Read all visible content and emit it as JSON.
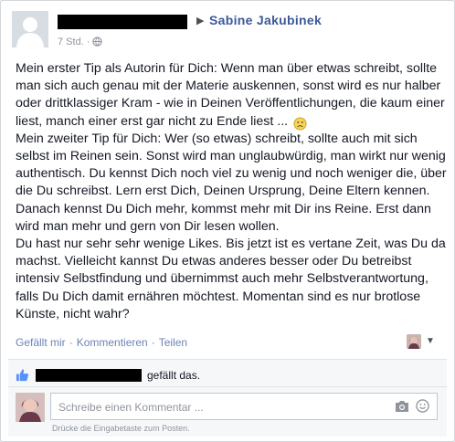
{
  "post": {
    "author_name": "Sabine Jakubinek",
    "time": "7 Std.",
    "separator": "·",
    "text": "Mein erster Tip als Autorin für Dich: Wenn man über etwas schreibt, sollte man sich auch genau mit der Materie auskennen, sonst wird es nur halber oder drittklassiger Kram - wie in Deinen Veröffentlichungen, die kaum einer liest, manch einer erst gar nicht zu Ende liest ...\nMein zweiter Tip für Dich: Wer (so etwas) schreibt, sollte auch mit sich selbst im Reinen sein. Sonst wird man unglaubwürdig, man wirkt nur wenig authentisch. Du kennst Dich noch viel zu wenig und noch weniger die, über die Du schreibst. Lern erst Dich, Deinen Ursprung, Deine Eltern kennen. Danach kennst Du Dich mehr, kommst mehr mit Dir ins Reine. Erst dann wird man mehr und gern von Dir lesen wollen.\nDu hast nur sehr sehr wenige Likes. Bis jetzt ist es vertane Zeit, was Du da machst. Vielleicht kannst Du etwas anderes besser oder Du betreibst intensiv Selbstfindung und übernimmst auch mehr Selbstverantwortung, falls Du Dich damit ernähren möchtest. Momentan sind es nur brotlose Künste, nicht wahr?"
  },
  "actions": {
    "like": "Gefällt mir",
    "comment": "Kommentieren",
    "share": "Teilen",
    "separator": "·"
  },
  "likes": {
    "text": "gefällt das."
  },
  "comment": {
    "placeholder": "Schreibe einen Kommentar ...",
    "hint": "Drücke die Eingabetaste zum Posten."
  },
  "icons": {
    "globe": "globe-icon",
    "smiley": "frown-emoticon-icon",
    "like": "thumbs-up-icon",
    "camera": "camera-icon",
    "emoji": "emoji-icon",
    "dropdown": "chevron-down-icon"
  },
  "colors": {
    "link": "#3b5998",
    "muted": "#90949c",
    "action_link": "#6d84b4"
  }
}
